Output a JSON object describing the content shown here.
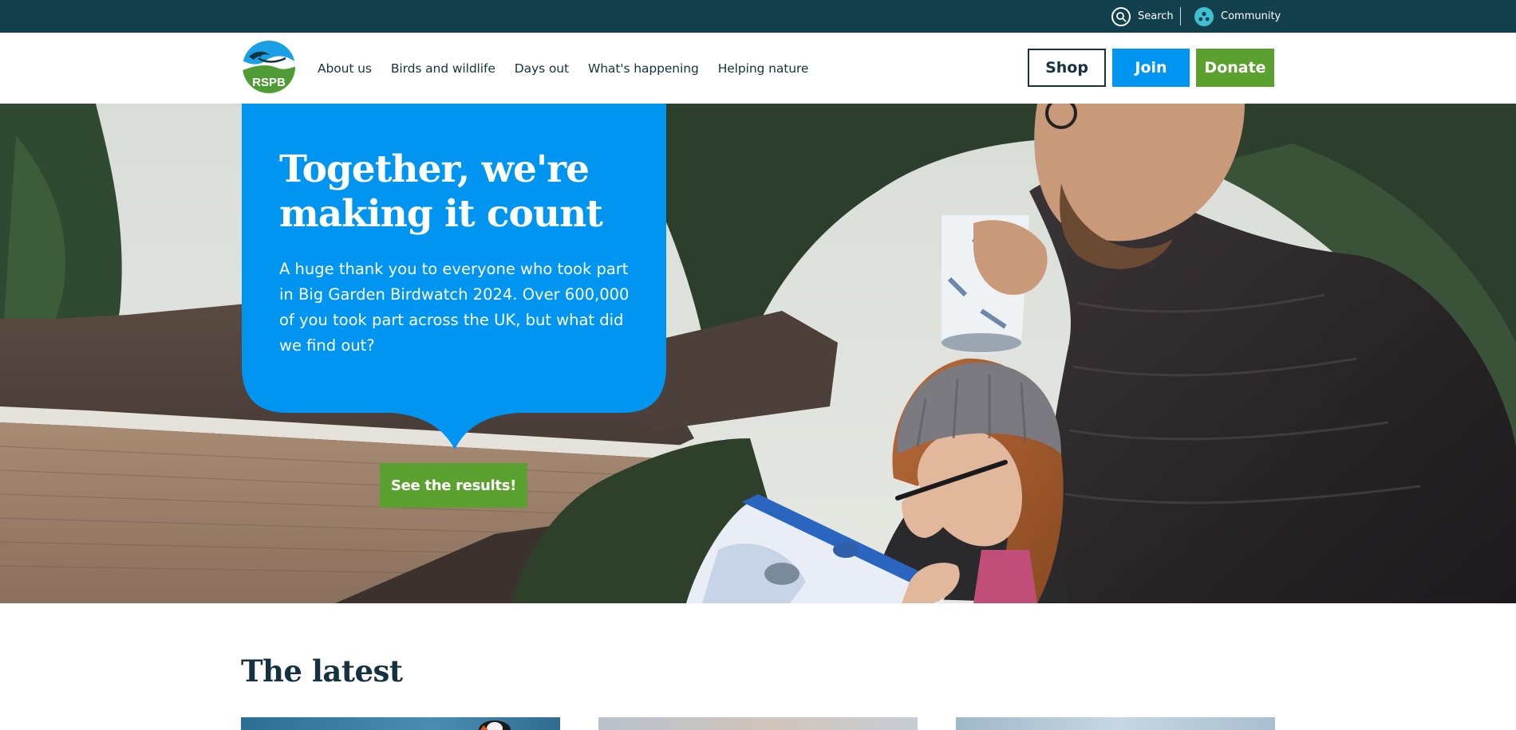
{
  "utility": {
    "search_label": "Search",
    "community_label": "Community"
  },
  "logo": {
    "text": "RSPB"
  },
  "nav": {
    "items": [
      {
        "label": "About us"
      },
      {
        "label": "Birds and wildlife"
      },
      {
        "label": "Days out"
      },
      {
        "label": "What's happening"
      },
      {
        "label": "Helping nature"
      }
    ]
  },
  "actions": {
    "shop": "Shop",
    "join": "Join",
    "donate": "Donate"
  },
  "hero": {
    "title": "Together, we're making it count",
    "text": "A huge thank you to everyone who took part in Big Garden Birdwatch 2024. Over 600,000 of you took part across the UK, but what did we find out?",
    "cta": "See the results!"
  },
  "latest": {
    "title": "The latest"
  },
  "colors": {
    "utility_bar": "#12404d",
    "brand_navy": "#14323f",
    "join_blue": "#0095f0",
    "donate_green": "#5ba12f",
    "community_teal": "#3fc0d1"
  },
  "icons": {
    "search": "search-icon",
    "community": "community-icon"
  }
}
